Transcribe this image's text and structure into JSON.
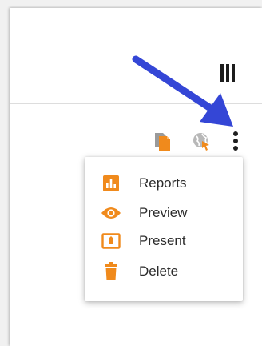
{
  "colors": {
    "accent": "#f08a1c",
    "arrow": "#3446d6",
    "text": "#2b2b2b"
  },
  "toolbar": {
    "icons": [
      "columns-icon",
      "document-icon",
      "globe-icon",
      "more-vert-icon"
    ]
  },
  "menu": {
    "items": [
      {
        "label": "Reports",
        "icon": "bar-chart-icon"
      },
      {
        "label": "Preview",
        "icon": "eye-icon"
      },
      {
        "label": "Present",
        "icon": "present-icon"
      },
      {
        "label": "Delete",
        "icon": "trash-icon"
      }
    ]
  }
}
